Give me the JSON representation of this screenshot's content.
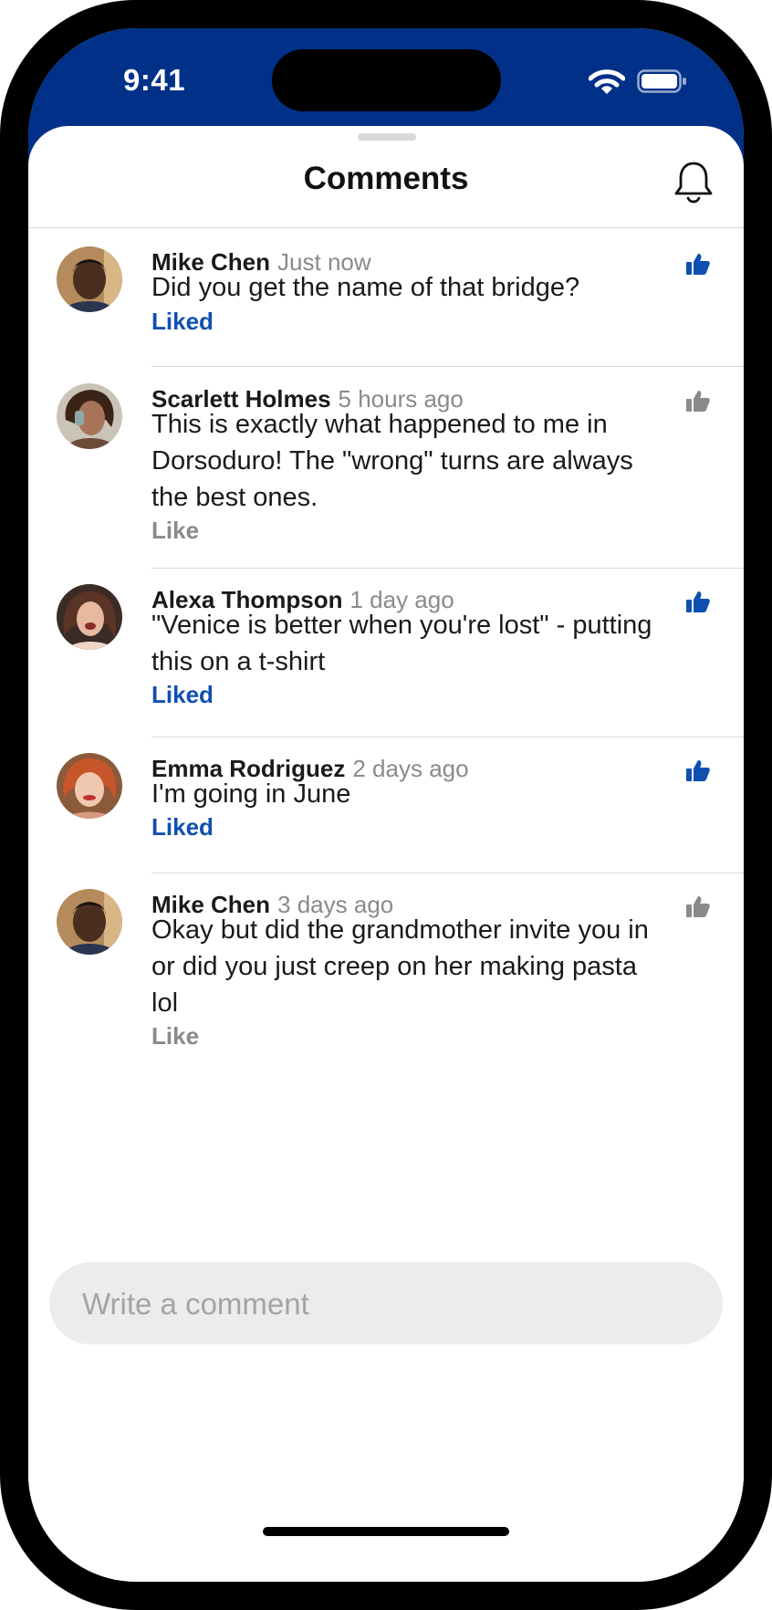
{
  "status_bar": {
    "time": "9:41",
    "icons": [
      "wifi-icon",
      "battery-icon"
    ]
  },
  "header": {
    "title": "Comments",
    "action_icon": "bell-icon"
  },
  "comments": [
    {
      "author": "Mike Chen",
      "time": "Just now",
      "text": "Did you get the name of that bridge?",
      "like_label": "Liked",
      "liked": true
    },
    {
      "author": "Scarlett Holmes",
      "time": "5 hours ago",
      "text": "This is exactly what happened to me in Dorsoduro! The \"wrong\" turns are always the best ones.",
      "like_label": "Like",
      "liked": false
    },
    {
      "author": "Alexa Thompson",
      "time": "1 day ago",
      "text": "\"Venice is better when you're lost\" - putting this on a t-shirt",
      "like_label": "Liked",
      "liked": true
    },
    {
      "author": "Emma Rodriguez",
      "time": "2 days ago",
      "text": "I'm going in June",
      "like_label": "Liked",
      "liked": true
    },
    {
      "author": "Mike Chen",
      "time": "3 days ago",
      "text": "Okay but did the grandmother invite you in or did you just creep on her making pasta lol",
      "like_label": "Like",
      "liked": false
    }
  ],
  "composer": {
    "placeholder": "Write a comment",
    "value": ""
  },
  "colors": {
    "brand": "#003087",
    "liked": "#0f4fb1",
    "muted": "#8a8a8a",
    "composer_bg": "#ececec"
  }
}
